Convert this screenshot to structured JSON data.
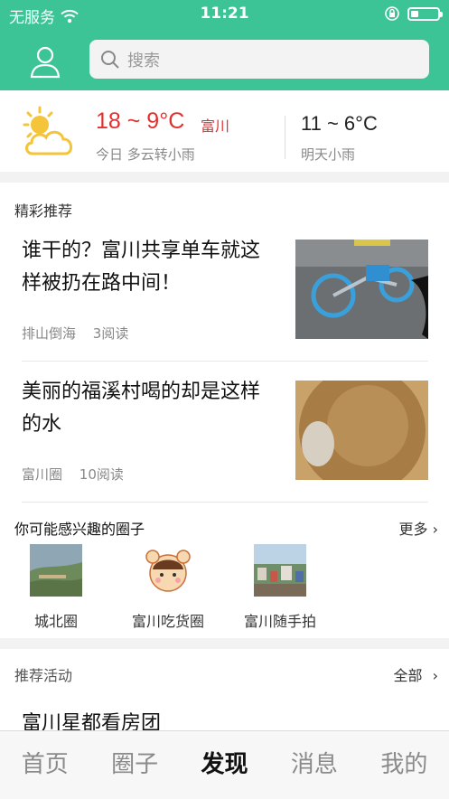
{
  "status_bar": {
    "carrier": "无服务",
    "time": "11:21"
  },
  "search": {
    "placeholder": "搜索"
  },
  "weather": {
    "today_temp": "18 ~ 9°C",
    "city": "富川",
    "today_desc": "今日 多云转小雨",
    "tomorrow_temp": "11 ~ 6°C",
    "tomorrow_desc": "明天小雨"
  },
  "recommend": {
    "title": "精彩推荐",
    "articles": [
      {
        "title": "谁干的？富川共享单车就这样被扔在路中间！",
        "source": "排山倒海",
        "reads": "3阅读"
      },
      {
        "title": "美丽的福溪村喝的却是这样的水",
        "source": "富川圈",
        "reads": "10阅读"
      }
    ]
  },
  "circles": {
    "title": "你可能感兴趣的圈子",
    "more": "更多",
    "items": [
      {
        "name": "城北圈"
      },
      {
        "name": "富川吃货圈"
      },
      {
        "name": "富川随手拍"
      }
    ]
  },
  "activities": {
    "title": "推荐活动",
    "all": "全部",
    "items": [
      {
        "title": "富川星都看房团"
      }
    ]
  },
  "tabs": [
    {
      "label": "首页"
    },
    {
      "label": "圈子"
    },
    {
      "label": "发现"
    },
    {
      "label": "消息"
    },
    {
      "label": "我的"
    }
  ],
  "colors": {
    "brand": "#3cc497",
    "temperature": "#e2302e"
  }
}
